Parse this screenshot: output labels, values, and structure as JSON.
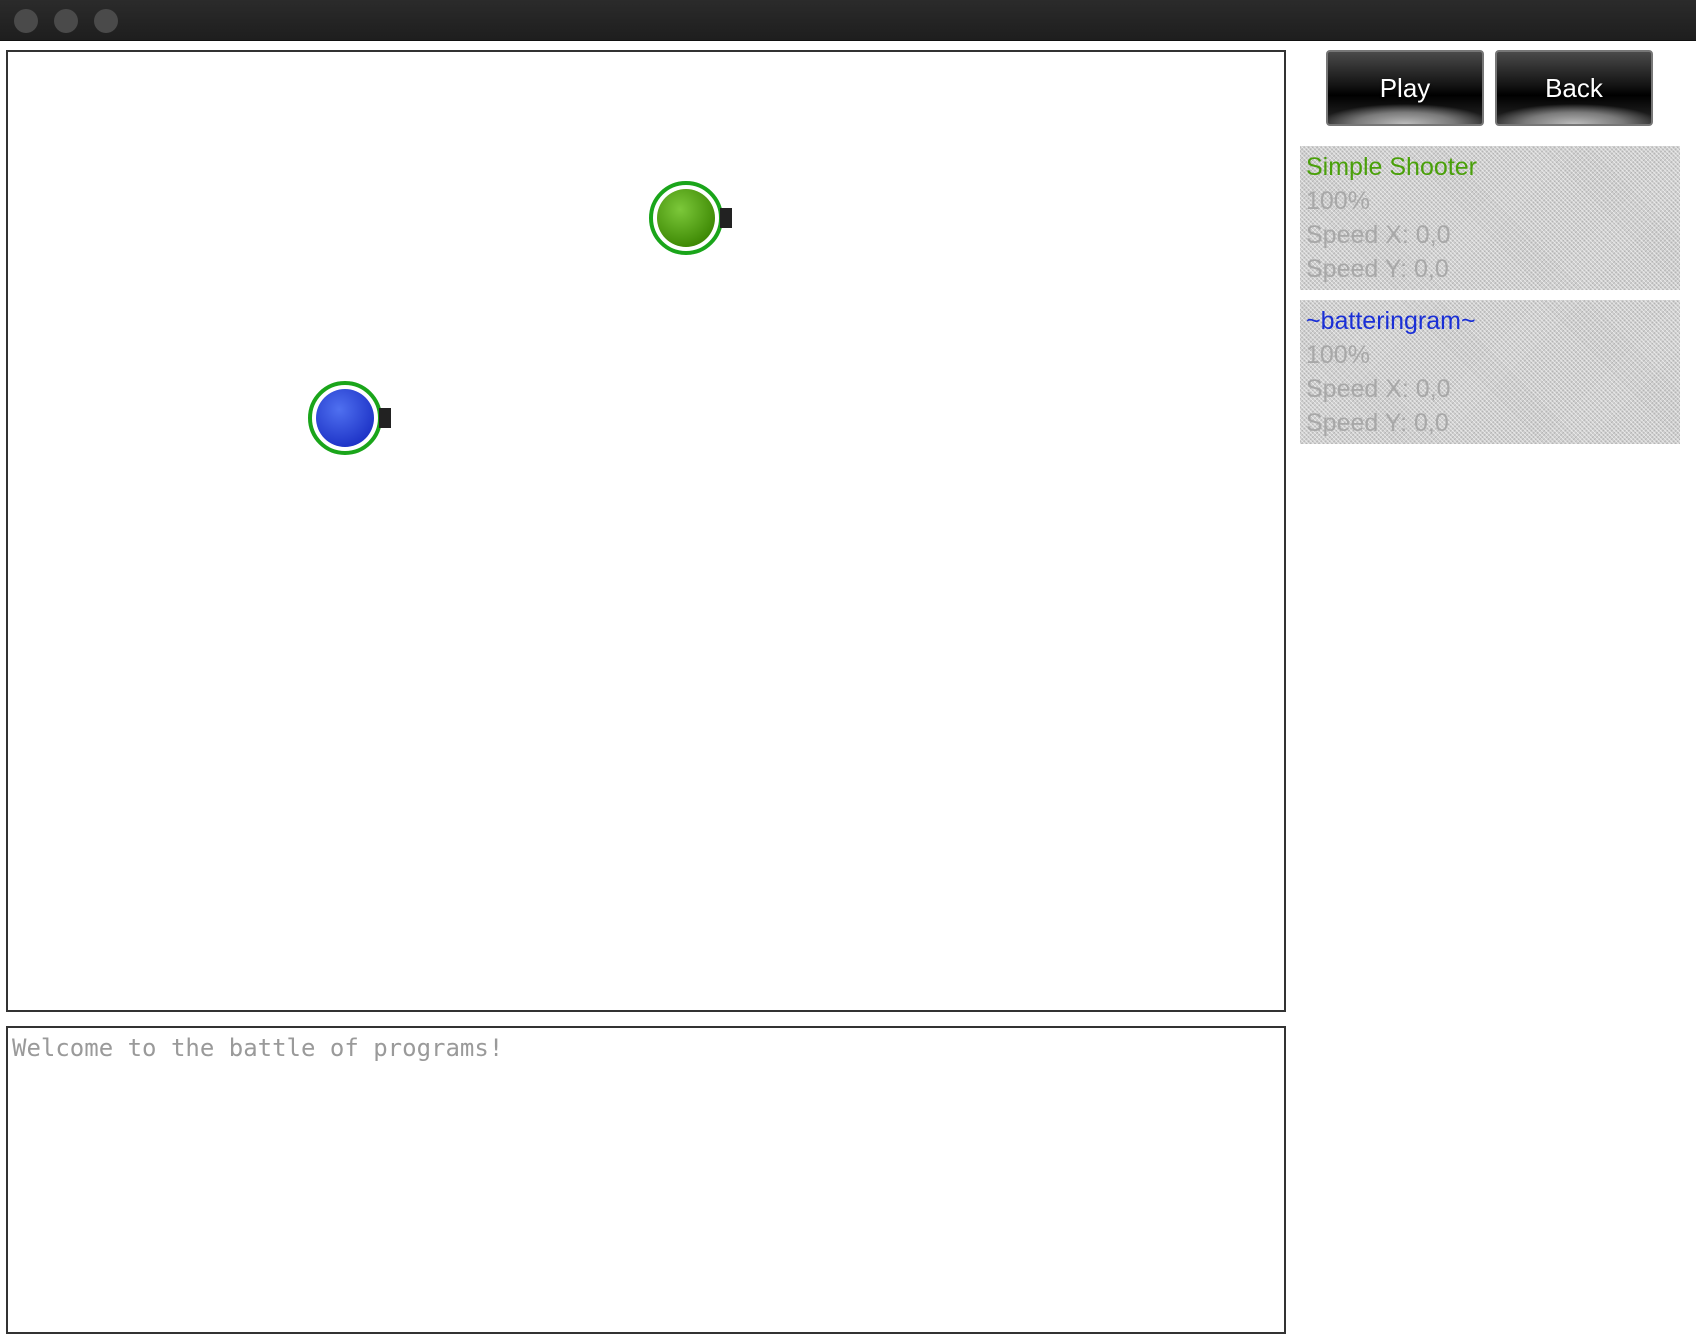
{
  "buttons": {
    "play_label": "Play",
    "back_label": "Back"
  },
  "robots": [
    {
      "name": "Simple Shooter",
      "color": "#4aa00a",
      "health": "100%",
      "speed_x": "Speed X: 0,0",
      "speed_y": "Speed Y: 0,0"
    },
    {
      "name": "~batteringram~",
      "color": "#1a2fd6",
      "health": "100%",
      "speed_x": "Speed X: 0,0",
      "speed_y": "Speed Y: 0,0"
    }
  ],
  "console": {
    "text": "Welcome to the battle of programs!"
  }
}
